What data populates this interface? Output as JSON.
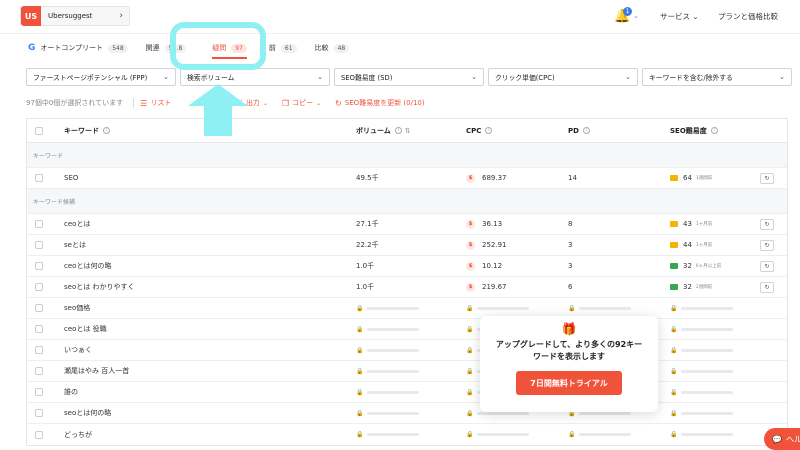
{
  "project": {
    "badge": "US",
    "name": "Ubersuggest",
    "chevron": "›"
  },
  "header": {
    "bell_count": "1",
    "services": "サービス",
    "plans": "プランと価格比較"
  },
  "tabs": [
    {
      "label": "オートコンプリート",
      "count": "548"
    },
    {
      "label": "関連",
      "count": "5…8"
    },
    {
      "label": "疑問",
      "count": "97",
      "active": true
    },
    {
      "label": "前",
      "count": "61"
    },
    {
      "label": "比較",
      "count": "48"
    }
  ],
  "filters": [
    {
      "label": "ファーストページポテンシャル (FPP)"
    },
    {
      "label": "検索ボリューム"
    },
    {
      "label": "SEO難易度 (SD)"
    },
    {
      "label": "クリック単価(CPC)"
    },
    {
      "label": "キーワードを含む/除外する"
    }
  ],
  "actions": {
    "selected": "97個中0個が選択されています",
    "list": "リスト",
    "export": "出力",
    "copy": "コピー",
    "update_sd": "SEO難易度を更新 (0/10)"
  },
  "columns": {
    "keyword": "キーワード",
    "volume": "ボリューム",
    "cpc": "CPC",
    "pd": "PD",
    "sd": "SEO難易度"
  },
  "sections": {
    "keyword": "キーワード",
    "ideas": "キーワード候補"
  },
  "main_row": {
    "keyword": "SEO",
    "volume": "49.5千",
    "cpc": "689.37",
    "pd": "14",
    "sd": "64",
    "sd_sub": "1週間前"
  },
  "rows": [
    {
      "keyword": "ceoとは",
      "volume": "27.1千",
      "cpc": "36.13",
      "pd": "8",
      "sd": "43",
      "sd_sub": "1ヶ月前",
      "level": "y"
    },
    {
      "keyword": "seとは",
      "volume": "22.2千",
      "cpc": "252.91",
      "pd": "3",
      "sd": "44",
      "sd_sub": "1ヶ月前",
      "level": "y"
    },
    {
      "keyword": "ceoとは何の略",
      "volume": "1.0千",
      "cpc": "10.12",
      "pd": "3",
      "sd": "32",
      "sd_sub": "6ヶ月以上前",
      "level": "g"
    },
    {
      "keyword": "seoとは わかりやすく",
      "volume": "1.0千",
      "cpc": "219.67",
      "pd": "6",
      "sd": "32",
      "sd_sub": "2週間前",
      "level": "g"
    }
  ],
  "locked_rows": [
    "seo価格",
    "ceoとは 役職",
    "いつぁく",
    "瀬尾はやみ 百人一首",
    "誰の",
    "seoとは何の略",
    "どっちが"
  ],
  "upsell": {
    "text": "アップグレードして、より多くの92キーワードを表示します",
    "button": "7日間無料トライアル"
  },
  "help": {
    "label": "ヘル"
  },
  "colors": {
    "accent": "#f0533a",
    "annotation": "#8ff0f4"
  }
}
